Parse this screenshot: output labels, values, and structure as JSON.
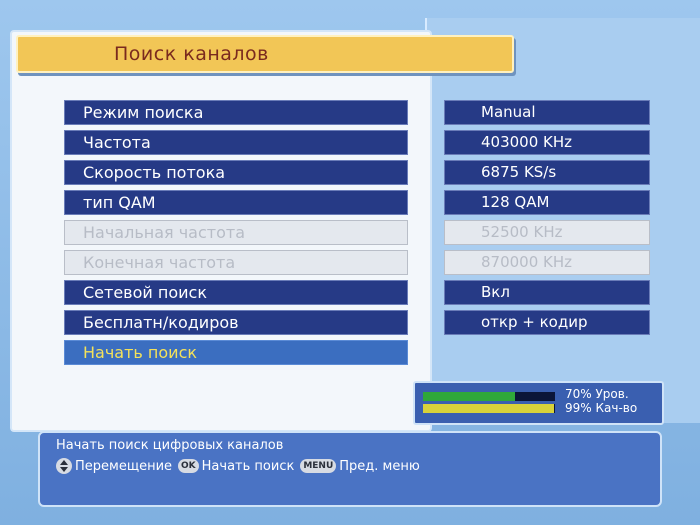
{
  "title": "Поиск каналов",
  "menu_items": [
    {
      "label": "Режим поиска",
      "state": "normal"
    },
    {
      "label": "Частота",
      "state": "normal"
    },
    {
      "label": "Скорость потока",
      "state": "normal"
    },
    {
      "label": "тип QAM",
      "state": "normal"
    },
    {
      "label": "Начальная частота",
      "state": "disabled"
    },
    {
      "label": "Конечная частота",
      "state": "disabled"
    },
    {
      "label": "Сетевой поиск",
      "state": "normal"
    },
    {
      "label": "Бесплатн/кодиров",
      "state": "normal"
    },
    {
      "label": "Начать поиск",
      "state": "selected"
    }
  ],
  "values": [
    {
      "text": "Manual",
      "state": "normal"
    },
    {
      "text": "403000 KHz",
      "state": "normal"
    },
    {
      "text": "6875 KS/s",
      "state": "normal"
    },
    {
      "text": "128 QAM",
      "state": "normal"
    },
    {
      "text": "52500 KHz",
      "state": "disabled"
    },
    {
      "text": "870000 KHz",
      "state": "disabled"
    },
    {
      "text": "Вкл",
      "state": "normal"
    },
    {
      "text": "откр + кодир",
      "state": "normal"
    }
  ],
  "signal": {
    "level_percent": 70,
    "quality_percent": 99,
    "level_label": "70% Уров.",
    "quality_label": "99% Кач-во"
  },
  "help": {
    "description": "Начать поиск цифровых каналов",
    "move_text": "Перемещение",
    "ok_key": "OK",
    "ok_text": "Начать поиск",
    "menu_key": "MENU",
    "menu_text": "Пред. меню"
  },
  "colors": {
    "title_bg": "#f2c656",
    "item_bg": "#263a86",
    "selected_text": "#f4e25a",
    "level_bar": "#2fa83a",
    "quality_bar": "#d8d23a"
  }
}
